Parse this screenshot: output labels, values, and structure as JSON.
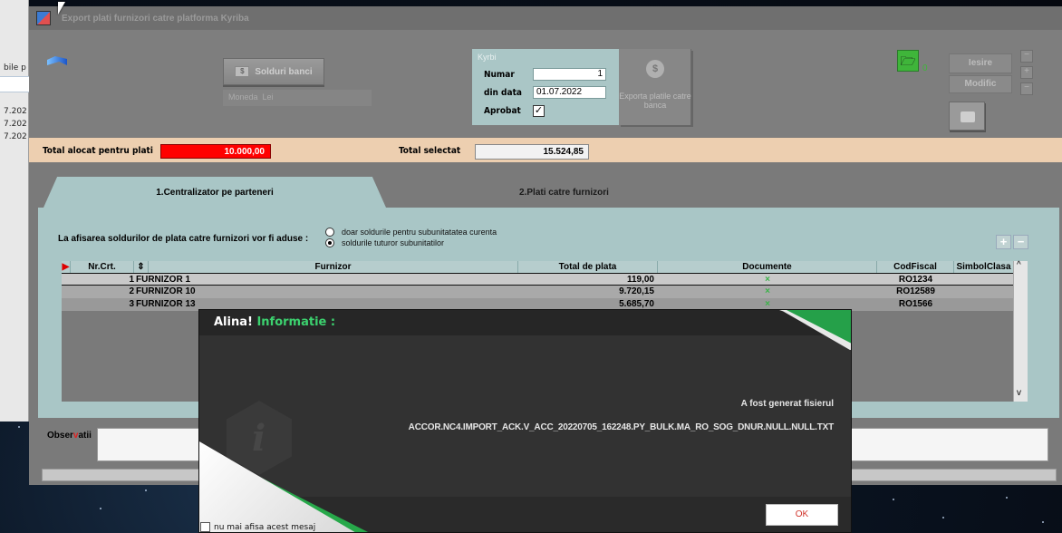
{
  "window": {
    "title": "Export plati furnizori catre platforma Kyriba"
  },
  "behind_window": {
    "labels": [
      "bile p",
      "7.202",
      "7.202",
      "7.202"
    ]
  },
  "toolbar": {
    "solduri_banci": "Solduri banci",
    "moneda_label": "Moneda",
    "moneda_value": "Lei",
    "exporta_label": "Exporta platile catre banca",
    "green_count": "0",
    "iesire": "Iesire",
    "modific": "Modific"
  },
  "kyrib": {
    "title": "Kyrbi",
    "numar_label": "Numar",
    "numar_value": "1",
    "din_data_label": "din data",
    "din_data_value": "01.07.2022",
    "aprobat_label": "Aprobat",
    "aprobat_checked": true
  },
  "totals": {
    "alocat_label": "Total alocat pentru plati",
    "alocat_value": "10.000,00",
    "selectat_label": "Total selectat",
    "selectat_value": "15.524,85"
  },
  "tabs": [
    {
      "label": "1.Centralizator pe parteneri",
      "active": true
    },
    {
      "label": "2.Plati catre furnizori",
      "active": false
    }
  ],
  "afisare": {
    "label": "La afisarea soldurilor de plata catre furnizori vor fi aduse :",
    "option1": "doar soldurile pentru subunitatatea curenta",
    "option2": "soldurile  tuturor subunitatilor",
    "selected": 2
  },
  "grid": {
    "headers": [
      "Nr.Crt.",
      "Furnizor",
      "Total de plata",
      "Documente",
      "CodFiscal",
      "SimbolClasa"
    ],
    "rows": [
      {
        "nr": "1",
        "furnizor": "FURNIZOR 1",
        "total": "119,00",
        "doc": "×",
        "cod": "RO1234",
        "simbol": ""
      },
      {
        "nr": "2",
        "furnizor": "FURNIZOR 10",
        "total": "9.720,15",
        "doc": "×",
        "cod": "RO12589",
        "simbol": ""
      },
      {
        "nr": "3",
        "furnizor": "FURNIZOR 13",
        "total": "5.685,70",
        "doc": "×",
        "cod": "RO1566",
        "simbol": ""
      }
    ]
  },
  "observatii": {
    "label_a": "Obser",
    "label_b": "v",
    "label_c": "atii"
  },
  "dialog": {
    "title_name": "Alina!",
    "title_info": "Informatie :",
    "message1": "A fost generat fisierul",
    "message2": "ACCOR.NC4.IMPORT_ACK.V_ACC_20220705_162248.PY_BULK.MA_RO_SOG_DNUR.NULL.NULL.TXT",
    "ok_label": "OK",
    "dont_show_label": "nu mai afisa acest mesaj",
    "icon_letter": "i"
  },
  "colors": {
    "accent_green": "#25a049",
    "alert_red": "#ff0000",
    "panel_teal": "#a9c6c6",
    "totals_band": "#edcfb0"
  }
}
